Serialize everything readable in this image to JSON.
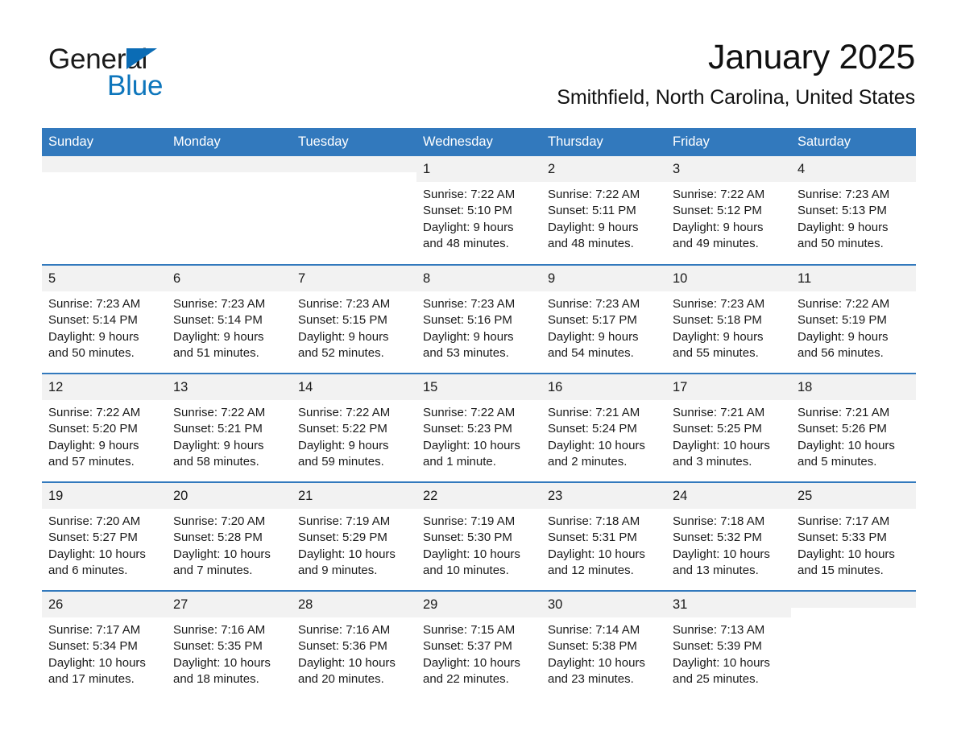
{
  "brand": {
    "name_part1": "General",
    "name_part2": "Blue",
    "triangle_color": "#0b6cb5",
    "blue_color": "#0e76bc"
  },
  "header": {
    "title": "January 2025",
    "subtitle": "Smithfield, North Carolina, United States"
  },
  "theme": {
    "header_blue": "#3279bd",
    "daynum_gray": "#f2f2f2",
    "text_color": "#1a1a1a"
  },
  "weekday_headers": [
    "Sunday",
    "Monday",
    "Tuesday",
    "Wednesday",
    "Thursday",
    "Friday",
    "Saturday"
  ],
  "weeks": [
    [
      {
        "day": "",
        "sunrise": "",
        "sunset": "",
        "daylight": "",
        "blank": true
      },
      {
        "day": "",
        "sunrise": "",
        "sunset": "",
        "daylight": "",
        "blank": true
      },
      {
        "day": "",
        "sunrise": "",
        "sunset": "",
        "daylight": "",
        "blank": true
      },
      {
        "day": "1",
        "sunrise": "Sunrise: 7:22 AM",
        "sunset": "Sunset: 5:10 PM",
        "daylight": "Daylight: 9 hours and 48 minutes."
      },
      {
        "day": "2",
        "sunrise": "Sunrise: 7:22 AM",
        "sunset": "Sunset: 5:11 PM",
        "daylight": "Daylight: 9 hours and 48 minutes."
      },
      {
        "day": "3",
        "sunrise": "Sunrise: 7:22 AM",
        "sunset": "Sunset: 5:12 PM",
        "daylight": "Daylight: 9 hours and 49 minutes."
      },
      {
        "day": "4",
        "sunrise": "Sunrise: 7:23 AM",
        "sunset": "Sunset: 5:13 PM",
        "daylight": "Daylight: 9 hours and 50 minutes."
      }
    ],
    [
      {
        "day": "5",
        "sunrise": "Sunrise: 7:23 AM",
        "sunset": "Sunset: 5:14 PM",
        "daylight": "Daylight: 9 hours and 50 minutes."
      },
      {
        "day": "6",
        "sunrise": "Sunrise: 7:23 AM",
        "sunset": "Sunset: 5:14 PM",
        "daylight": "Daylight: 9 hours and 51 minutes."
      },
      {
        "day": "7",
        "sunrise": "Sunrise: 7:23 AM",
        "sunset": "Sunset: 5:15 PM",
        "daylight": "Daylight: 9 hours and 52 minutes."
      },
      {
        "day": "8",
        "sunrise": "Sunrise: 7:23 AM",
        "sunset": "Sunset: 5:16 PM",
        "daylight": "Daylight: 9 hours and 53 minutes."
      },
      {
        "day": "9",
        "sunrise": "Sunrise: 7:23 AM",
        "sunset": "Sunset: 5:17 PM",
        "daylight": "Daylight: 9 hours and 54 minutes."
      },
      {
        "day": "10",
        "sunrise": "Sunrise: 7:23 AM",
        "sunset": "Sunset: 5:18 PM",
        "daylight": "Daylight: 9 hours and 55 minutes."
      },
      {
        "day": "11",
        "sunrise": "Sunrise: 7:22 AM",
        "sunset": "Sunset: 5:19 PM",
        "daylight": "Daylight: 9 hours and 56 minutes."
      }
    ],
    [
      {
        "day": "12",
        "sunrise": "Sunrise: 7:22 AM",
        "sunset": "Sunset: 5:20 PM",
        "daylight": "Daylight: 9 hours and 57 minutes."
      },
      {
        "day": "13",
        "sunrise": "Sunrise: 7:22 AM",
        "sunset": "Sunset: 5:21 PM",
        "daylight": "Daylight: 9 hours and 58 minutes."
      },
      {
        "day": "14",
        "sunrise": "Sunrise: 7:22 AM",
        "sunset": "Sunset: 5:22 PM",
        "daylight": "Daylight: 9 hours and 59 minutes."
      },
      {
        "day": "15",
        "sunrise": "Sunrise: 7:22 AM",
        "sunset": "Sunset: 5:23 PM",
        "daylight": "Daylight: 10 hours and 1 minute."
      },
      {
        "day": "16",
        "sunrise": "Sunrise: 7:21 AM",
        "sunset": "Sunset: 5:24 PM",
        "daylight": "Daylight: 10 hours and 2 minutes."
      },
      {
        "day": "17",
        "sunrise": "Sunrise: 7:21 AM",
        "sunset": "Sunset: 5:25 PM",
        "daylight": "Daylight: 10 hours and 3 minutes."
      },
      {
        "day": "18",
        "sunrise": "Sunrise: 7:21 AM",
        "sunset": "Sunset: 5:26 PM",
        "daylight": "Daylight: 10 hours and 5 minutes."
      }
    ],
    [
      {
        "day": "19",
        "sunrise": "Sunrise: 7:20 AM",
        "sunset": "Sunset: 5:27 PM",
        "daylight": "Daylight: 10 hours and 6 minutes."
      },
      {
        "day": "20",
        "sunrise": "Sunrise: 7:20 AM",
        "sunset": "Sunset: 5:28 PM",
        "daylight": "Daylight: 10 hours and 7 minutes."
      },
      {
        "day": "21",
        "sunrise": "Sunrise: 7:19 AM",
        "sunset": "Sunset: 5:29 PM",
        "daylight": "Daylight: 10 hours and 9 minutes."
      },
      {
        "day": "22",
        "sunrise": "Sunrise: 7:19 AM",
        "sunset": "Sunset: 5:30 PM",
        "daylight": "Daylight: 10 hours and 10 minutes."
      },
      {
        "day": "23",
        "sunrise": "Sunrise: 7:18 AM",
        "sunset": "Sunset: 5:31 PM",
        "daylight": "Daylight: 10 hours and 12 minutes."
      },
      {
        "day": "24",
        "sunrise": "Sunrise: 7:18 AM",
        "sunset": "Sunset: 5:32 PM",
        "daylight": "Daylight: 10 hours and 13 minutes."
      },
      {
        "day": "25",
        "sunrise": "Sunrise: 7:17 AM",
        "sunset": "Sunset: 5:33 PM",
        "daylight": "Daylight: 10 hours and 15 minutes."
      }
    ],
    [
      {
        "day": "26",
        "sunrise": "Sunrise: 7:17 AM",
        "sunset": "Sunset: 5:34 PM",
        "daylight": "Daylight: 10 hours and 17 minutes."
      },
      {
        "day": "27",
        "sunrise": "Sunrise: 7:16 AM",
        "sunset": "Sunset: 5:35 PM",
        "daylight": "Daylight: 10 hours and 18 minutes."
      },
      {
        "day": "28",
        "sunrise": "Sunrise: 7:16 AM",
        "sunset": "Sunset: 5:36 PM",
        "daylight": "Daylight: 10 hours and 20 minutes."
      },
      {
        "day": "29",
        "sunrise": "Sunrise: 7:15 AM",
        "sunset": "Sunset: 5:37 PM",
        "daylight": "Daylight: 10 hours and 22 minutes."
      },
      {
        "day": "30",
        "sunrise": "Sunrise: 7:14 AM",
        "sunset": "Sunset: 5:38 PM",
        "daylight": "Daylight: 10 hours and 23 minutes."
      },
      {
        "day": "31",
        "sunrise": "Sunrise: 7:13 AM",
        "sunset": "Sunset: 5:39 PM",
        "daylight": "Daylight: 10 hours and 25 minutes."
      },
      {
        "day": "",
        "sunrise": "",
        "sunset": "",
        "daylight": "",
        "blank": true
      }
    ]
  ]
}
